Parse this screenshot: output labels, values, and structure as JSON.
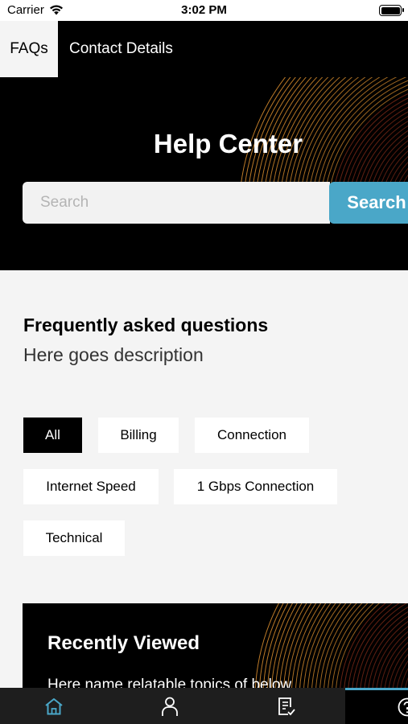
{
  "status": {
    "carrier": "Carrier",
    "time": "3:02 PM"
  },
  "tabs": [
    {
      "label": "FAQs",
      "active": true
    },
    {
      "label": "Contact Details",
      "active": false
    }
  ],
  "hero": {
    "title": "Help Center",
    "search_placeholder": "Search",
    "search_button": "Search"
  },
  "faq": {
    "title": "Frequently asked questions",
    "description": "Here goes description",
    "categories": [
      "All",
      "Billing",
      "Connection",
      "Internet Speed",
      "1 Gbps Connection",
      "Technical"
    ],
    "selected": "All"
  },
  "recent": {
    "title": "Recently Viewed",
    "subtitle": "Here name relatable topics of below"
  },
  "bottom_nav": [
    {
      "icon": "home-icon",
      "active": true
    },
    {
      "icon": "person-icon",
      "active": false
    },
    {
      "icon": "document-check-icon",
      "active": false
    },
    {
      "icon": "help-icon",
      "active": false
    }
  ],
  "colors": {
    "accent": "#4aa7c8",
    "background": "#f4f4f4",
    "dark": "#000000",
    "pattern": "#c8782a"
  }
}
